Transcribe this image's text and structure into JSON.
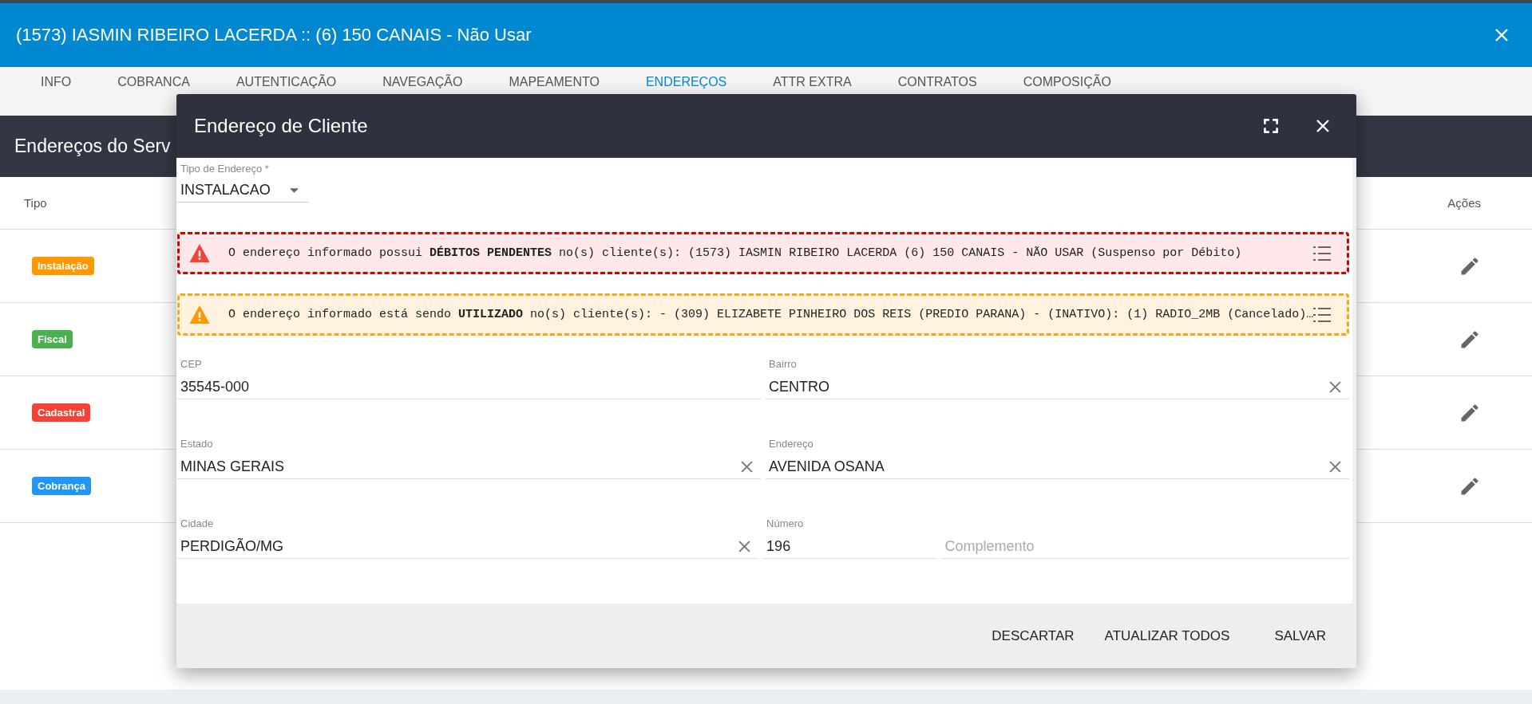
{
  "window": {
    "title": "(1573) IASMIN RIBEIRO LACERDA :: (6) 150 CANAIS - Não Usar"
  },
  "tabs": [
    {
      "label": "INFO",
      "selected": false
    },
    {
      "label": "COBRANCA",
      "selected": false
    },
    {
      "label": "AUTENTICAÇÃO",
      "selected": false
    },
    {
      "label": "NAVEGAÇÃO",
      "selected": false
    },
    {
      "label": "MAPEAMENTO",
      "selected": false
    },
    {
      "label": "ENDEREÇOS",
      "selected": true
    },
    {
      "label": "ATTR EXTRA",
      "selected": false
    },
    {
      "label": "CONTRATOS",
      "selected": false
    },
    {
      "label": "COMPOSIÇÃO",
      "selected": false
    }
  ],
  "section_title": "Endereços do Serv",
  "table": {
    "columns": [
      "Tipo",
      "Ações"
    ],
    "rows": [
      {
        "tipo": "Instalação",
        "color": "#ff9800"
      },
      {
        "tipo": "Fiscal",
        "color": "#4caf50"
      },
      {
        "tipo": "Cadastral",
        "color": "#f44336"
      },
      {
        "tipo": "Cobrança",
        "color": "#2196f3"
      }
    ]
  },
  "dialog": {
    "title": "Endereço de Cliente",
    "address_type": {
      "label": "Tipo de Endereço *",
      "value": "INSTALACAO"
    },
    "alerts": [
      {
        "kind": "error",
        "text": "O endereço informado possui **DÉBITOS PENDENTES** no(s) cliente(s): (1573) IASMIN RIBEIRO LACERDA (6) 150 CANAIS - NÃO USAR (Suspenso por Débito)"
      },
      {
        "kind": "warning",
        "text": "O endereço informado está sendo **UTILIZADO** no(s) cliente(s): - (309) ELIZABETE PINHEIRO DOS REIS (PREDIO PARANA) - (INATIVO): (1) RADIO_2MB (Cancelado)…"
      }
    ],
    "rows": [
      {
        "fields": [
          {
            "label": "CEP",
            "value": "35545-000",
            "clearable": false
          },
          {
            "label": "Bairro",
            "value": "CENTRO",
            "clearable": true
          }
        ]
      },
      {
        "fields": [
          {
            "label": "Estado",
            "value": "MINAS GERAIS",
            "clearable": true
          },
          {
            "label": "Endereço",
            "value": "AVENIDA OSANA",
            "clearable": true
          }
        ]
      },
      {
        "fields": [
          {
            "label": "Cidade",
            "value": "PERDIGÃO/MG",
            "clearable": true
          },
          {
            "label": "Número",
            "value": "196",
            "clearable": false
          },
          {
            "placeholder": "Complemento",
            "clearable": false
          }
        ]
      }
    ],
    "buttons": [
      "DESCARTAR",
      "ATUALIZAR TODOS",
      "SALVAR"
    ]
  }
}
